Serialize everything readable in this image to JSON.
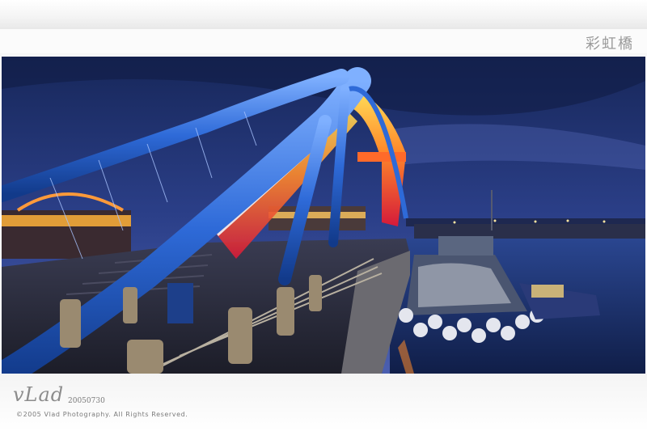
{
  "caption": "彩虹橋",
  "signature": {
    "name": "vLad",
    "date": "20050730"
  },
  "copyright": "©2005 Vlad Photography. All Rights Reserved.",
  "colors": {
    "sky_top": "#1a2a5c",
    "sky_bottom": "#3a4fa0",
    "bridge_blue": "#2f6fe0",
    "water": "#1c3270",
    "lights_warm": "#ffb23a",
    "lights_red": "#e0203a"
  }
}
